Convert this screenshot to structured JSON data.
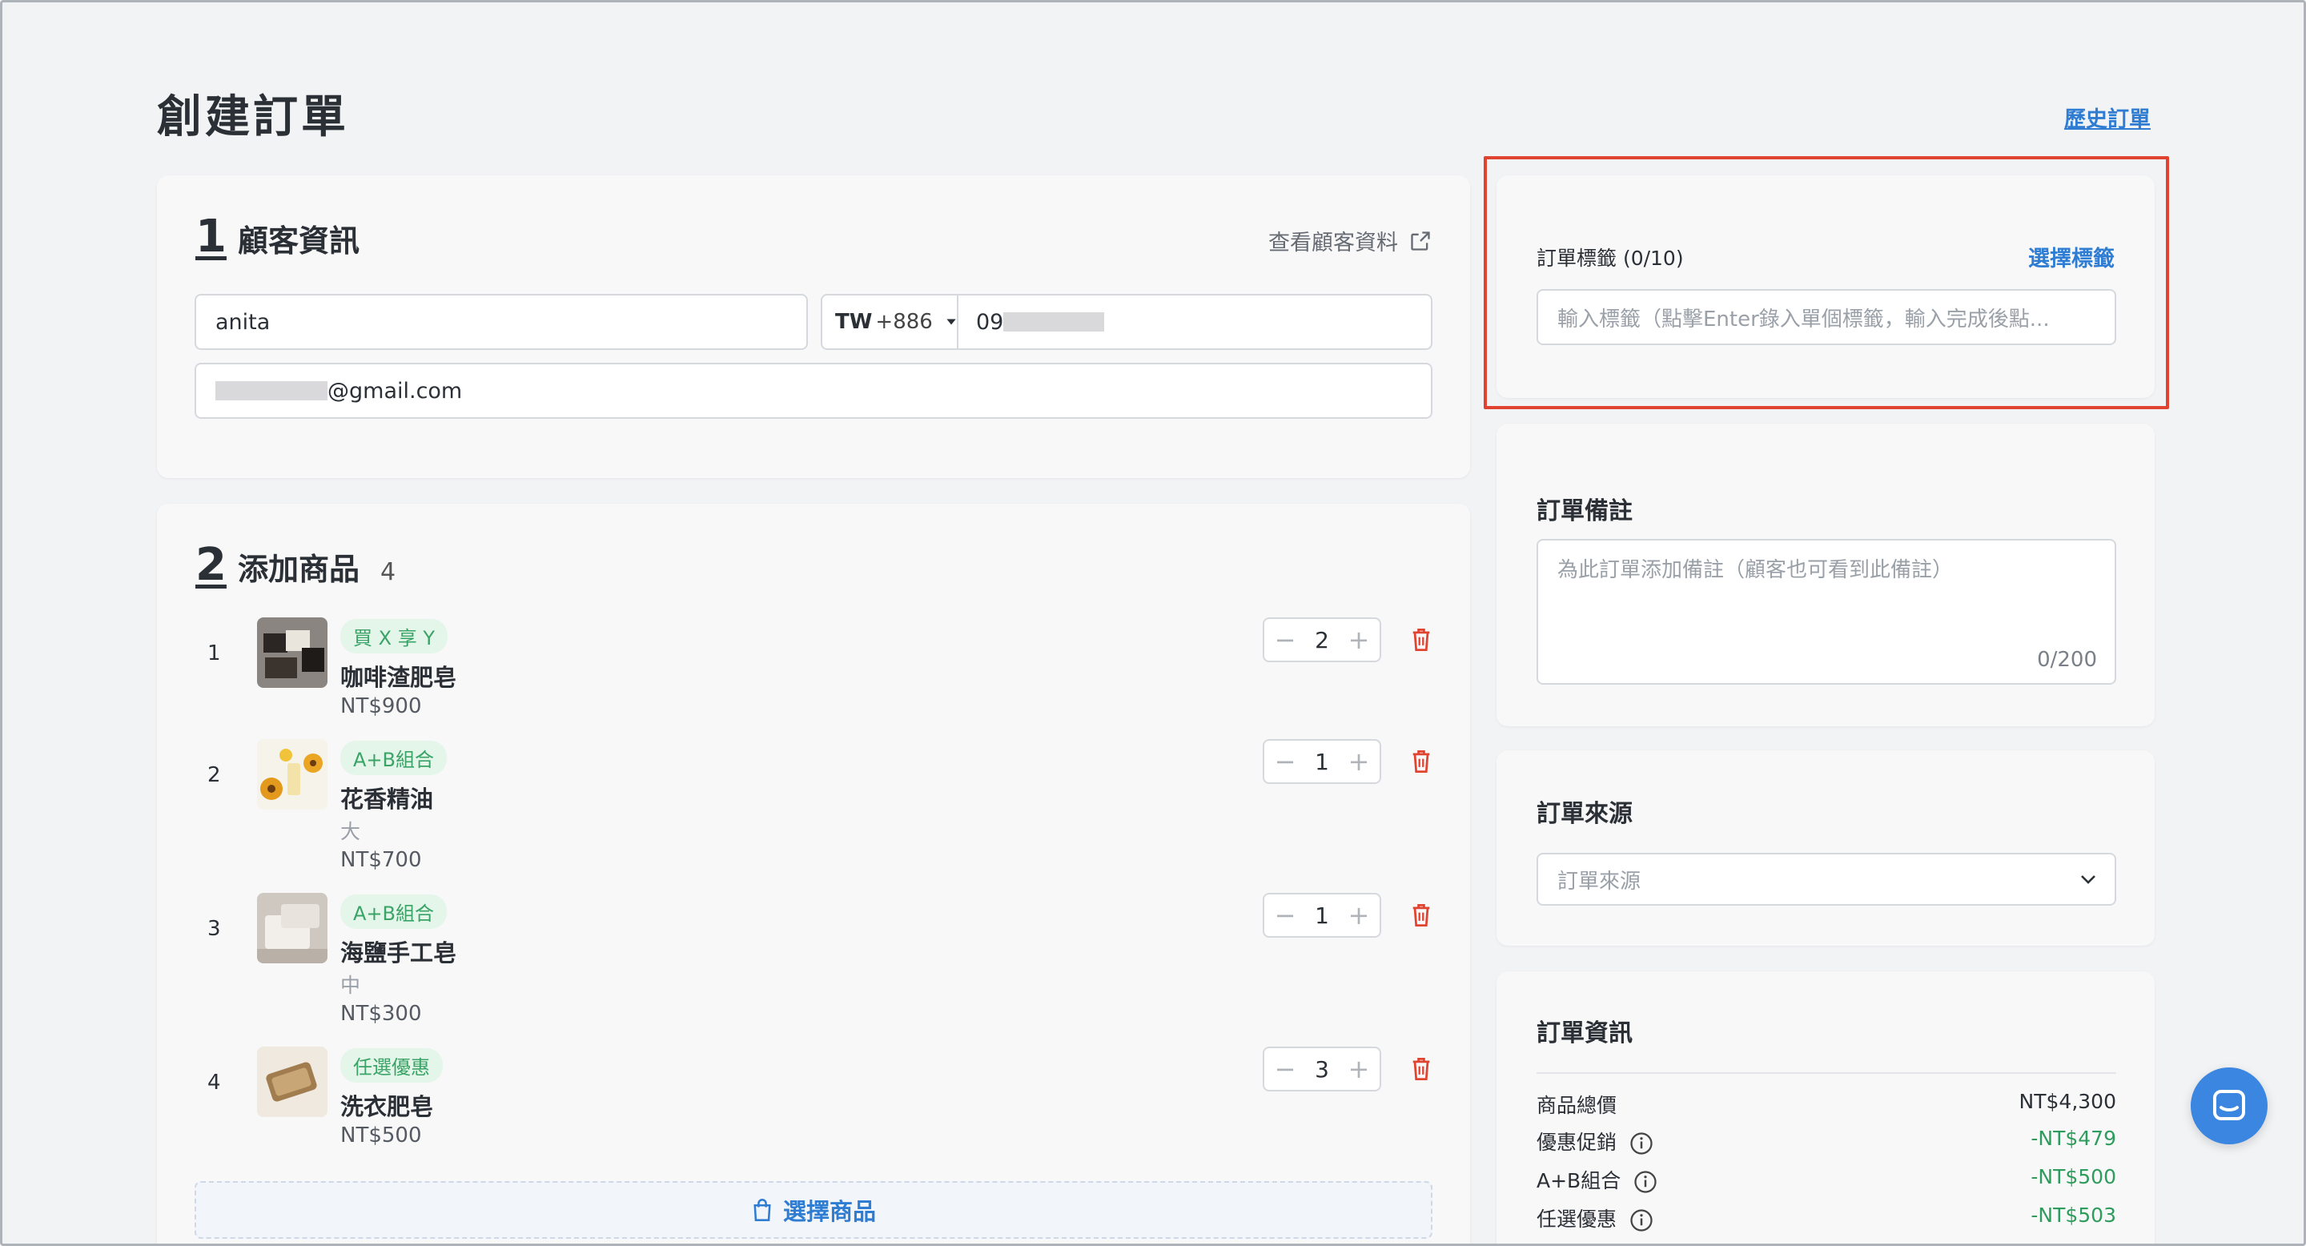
{
  "page": {
    "title": "創建訂單",
    "history_link": "歷史訂單"
  },
  "customer": {
    "section_num": "1",
    "section_label": "顧客資訊",
    "view_link": "查看顧客資料",
    "name_value": "anita",
    "country_code": "TW",
    "dial_code": "+886",
    "phone_value": "09",
    "email_value": "@gmail.com"
  },
  "products": {
    "section_num": "2",
    "section_label": "添加商品",
    "count": "4",
    "items": [
      {
        "index": "1",
        "tag": "買 X 享 Y",
        "name": "咖啡渣肥皂",
        "variant": "",
        "price": "NT$900",
        "qty": "2"
      },
      {
        "index": "2",
        "tag": "A+B組合",
        "name": "花香精油",
        "variant": "大",
        "price": "NT$700",
        "qty": "1"
      },
      {
        "index": "3",
        "tag": "A+B組合",
        "name": "海鹽手工皂",
        "variant": "中",
        "price": "NT$300",
        "qty": "1"
      },
      {
        "index": "4",
        "tag": "任選優惠",
        "name": "洗衣肥皂",
        "variant": "",
        "price": "NT$500",
        "qty": "3"
      }
    ],
    "select_button": "選擇商品"
  },
  "tags": {
    "label": "訂單標籤 (0/10)",
    "select_link": "選擇標籤",
    "placeholder": "輸入標籤（點擊Enter錄入單個標籤，輸入完成後點..."
  },
  "notes": {
    "label": "訂單備註",
    "placeholder": "為此訂單添加備註（顧客也可看到此備註）",
    "counter": "0/200"
  },
  "source": {
    "label": "訂單來源",
    "placeholder": "訂單來源"
  },
  "summary": {
    "label": "訂單資訊",
    "rows": [
      {
        "name": "商品總價",
        "value": "NT$4,300",
        "info": false
      },
      {
        "name": "優惠促銷",
        "value": "-NT$479",
        "info": true
      },
      {
        "name": "A+B組合",
        "value": "-NT$500",
        "info": true
      },
      {
        "name": "任選優惠",
        "value": "-NT$503",
        "info": true
      }
    ]
  },
  "colors": {
    "accent": "#2f7dd3",
    "tag_green": "#3aa366",
    "delete_red": "#e0432f",
    "highlight": "#e0432f"
  }
}
